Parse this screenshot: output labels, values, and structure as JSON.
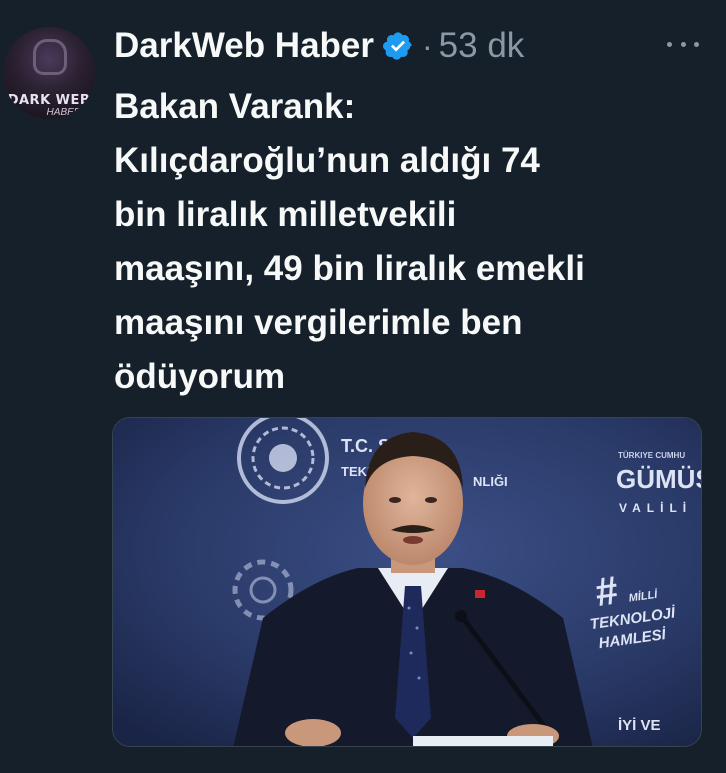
{
  "tweet": {
    "author": {
      "display_name": "DarkWeb Haber",
      "avatar_text_top": "DARK WEB",
      "avatar_text_bottom": "HABER",
      "verified_icon": "verified-badge-icon"
    },
    "separator": "·",
    "time": "53 dk",
    "more_icon": "more-options-icon",
    "text_lines": [
      "Bakan Varank:",
      "Kılıçdaroğlu’nun aldığı 74",
      "bin liralık milletvekili",
      "maaşını, 49 bin liralık emekli",
      "maaşını vergilerimle ben",
      "ödüyorum"
    ],
    "media": {
      "backdrop_text_top_left": "T.C. S",
      "backdrop_text_tekn": "TEKN",
      "backdrop_text_nligi": "NLIĞI",
      "backdrop_text_right_small": "TÜRKIYE CUMHU",
      "backdrop_text_right_big": "GÜMÜŞ",
      "backdrop_text_right_sub": "VALİLİ",
      "backdrop_hash": "#",
      "backdrop_milli": "MİLLİ",
      "backdrop_teknoloji": "TEKNOLOJİ",
      "backdrop_hamlesi": "HAMLESİ",
      "backdrop_bottom": "İYİ VE"
    }
  },
  "colors": {
    "background": "#15202b",
    "text_primary": "#f7f9f9",
    "text_secondary": "#8b98a5",
    "verified": "#1d9bf0"
  }
}
